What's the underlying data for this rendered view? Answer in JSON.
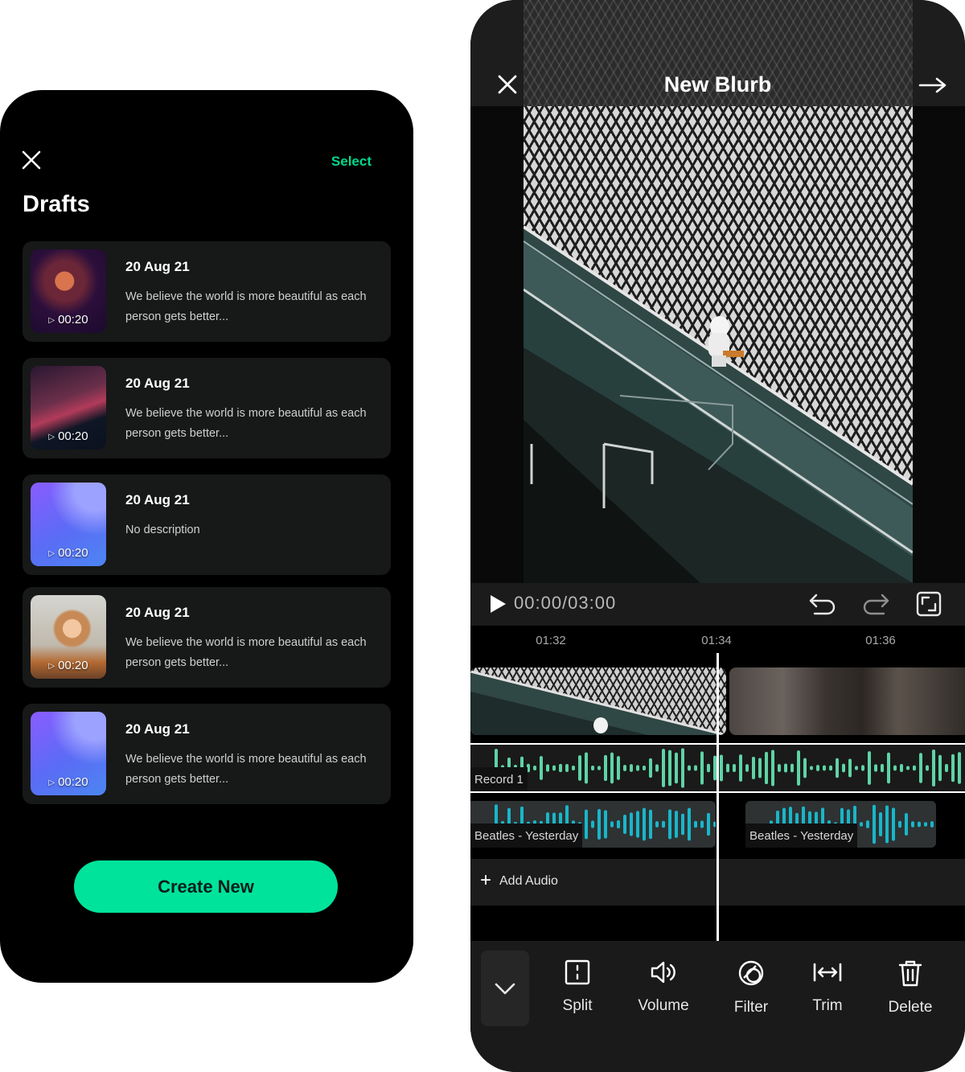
{
  "drafts_screen": {
    "select_label": "Select",
    "title": "Drafts",
    "items": [
      {
        "date": "20 Aug 21",
        "description": "We believe the world is more beautiful as each person gets better...",
        "duration": "00:20",
        "thumbnail": "portrait"
      },
      {
        "date": "20 Aug 21",
        "description": "We believe the world is more beautiful as each person gets better...",
        "duration": "00:20",
        "thumbnail": "turntable"
      },
      {
        "date": "20 Aug 21",
        "description": "No description",
        "duration": "00:20",
        "thumbnail": "gradient"
      },
      {
        "date": "20 Aug 21",
        "description": "We believe the world is more beautiful as each person gets better...",
        "duration": "00:20",
        "thumbnail": "singer"
      },
      {
        "date": "20 Aug 21",
        "description": "We believe the world is more beautiful as each person gets better...",
        "duration": "00:20",
        "thumbnail": "gradient"
      }
    ],
    "create_label": "Create New",
    "accent_color": "#00e39a"
  },
  "editor_screen": {
    "title": "New Blurb",
    "timecode": "00:00/03:00",
    "ruler_ticks": [
      "01:32",
      "01:34",
      "01:36"
    ],
    "tracks": {
      "record_label": "Record 1",
      "music_label_a": "Beatles - Yesterday",
      "music_label_b": "Beatles - Yesterday",
      "add_audio_label": "Add Audio"
    },
    "toolbar": {
      "split_label": "Split",
      "volume_label": "Volume",
      "filter_label": "Filter",
      "trim_label": "Trim",
      "delete_label": "Delete"
    },
    "colors": {
      "record_wave": "#5fd3a6",
      "music_wave": "#19b6c9"
    },
    "icons": [
      "close-icon",
      "arrow-right-icon",
      "play-icon",
      "undo-icon",
      "redo-icon",
      "fullscreen-icon",
      "plus-icon",
      "chevron-down-icon",
      "split-icon",
      "volume-icon",
      "filter-icon",
      "trim-icon",
      "trash-icon"
    ]
  }
}
